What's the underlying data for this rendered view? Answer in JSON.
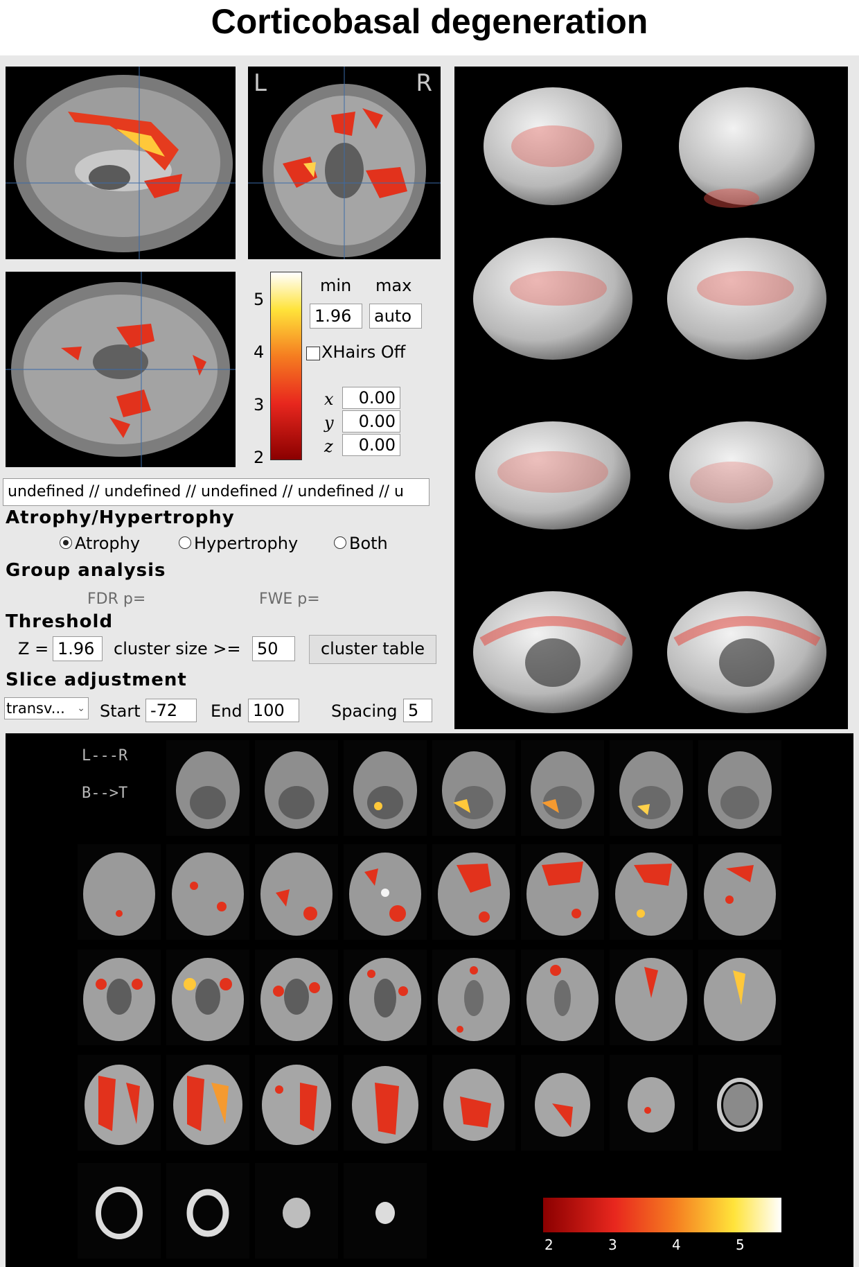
{
  "title": "Corticobasal degeneration",
  "orientation": {
    "left": "L",
    "right": "R"
  },
  "colorbar": {
    "ticks": [
      "5",
      "4",
      "3",
      "2"
    ],
    "min_label": "min",
    "max_label": "max",
    "min_value": "1.96",
    "max_value": "auto",
    "colors": [
      "#8b0000",
      "#e8271e",
      "#f57c20",
      "#ffe33a",
      "#ffffff"
    ]
  },
  "xhairs_label": "XHairs Off",
  "coords": {
    "x_label": "x",
    "y_label": "y",
    "z_label": "z",
    "x": "0.00",
    "y": "0.00",
    "z": "0.00"
  },
  "info_text": "undefined // undefined // undefined // undefined // u",
  "atrophy": {
    "heading": "Atrophy/Hypertrophy",
    "options": [
      "Atrophy",
      "Hypertrophy",
      "Both"
    ],
    "selected": "Atrophy"
  },
  "group": {
    "heading": "Group analysis",
    "fdr_label": "FDR p=",
    "fwe_label": "FWE p="
  },
  "threshold": {
    "heading": "Threshold",
    "z_label": "Z =",
    "z_value": "1.96",
    "cluster_label": "cluster size >=",
    "cluster_value": "50",
    "cluster_button": "cluster table"
  },
  "slice": {
    "heading": "Slice adjustment",
    "select_value": "transv...",
    "start_label": "Start",
    "start_value": "-72",
    "end_label": "End",
    "end_value": "100",
    "spacing_label": "Spacing",
    "spacing_value": "5"
  },
  "montage": {
    "lr_label": "L---R",
    "bt_label": "B-->T",
    "colorbar_ticks": [
      "2",
      "3",
      "4",
      "5"
    ]
  }
}
